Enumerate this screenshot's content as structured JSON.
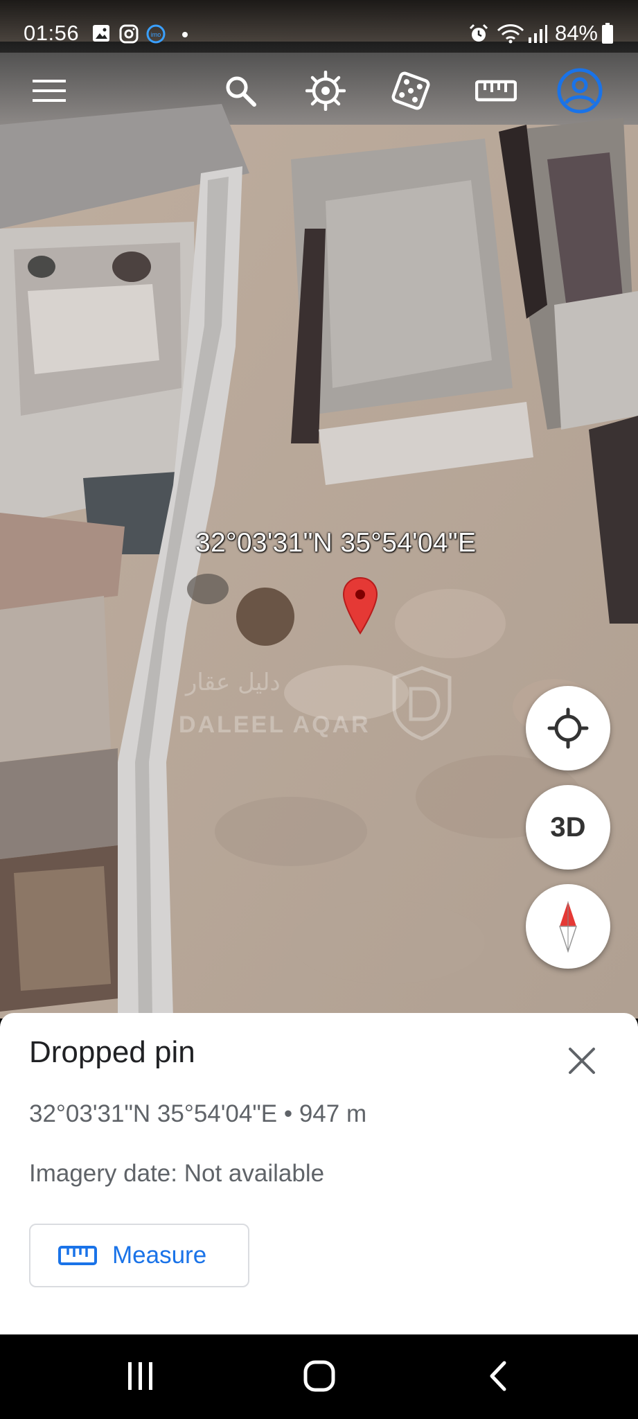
{
  "status_bar": {
    "time": "01:56",
    "battery": "84%",
    "notification_icons": [
      "gallery-icon",
      "instagram-icon",
      "imo-icon",
      "dot-icon"
    ],
    "system_icons": [
      "alarm-icon",
      "wifi-icon",
      "signal-icon",
      "battery-icon"
    ]
  },
  "toolbar": {
    "icons": [
      "menu-icon",
      "search-icon",
      "voyager-icon",
      "feeling-lucky-dice-icon",
      "ruler-icon",
      "account-icon"
    ]
  },
  "map": {
    "pin_label": "32°03'31\"N 35°54'04\"E",
    "watermark_arabic": "دليل عقار",
    "watermark_english": "DALEEL AQAR"
  },
  "fabs": {
    "three_d_label": "3D"
  },
  "sheet": {
    "title": "Dropped pin",
    "coordinates": "32°03'31\"N 35°54'04\"E • 947 m",
    "imagery": "Imagery date: Not available",
    "measure_label": "Measure"
  },
  "colors": {
    "accent": "#1a73e8",
    "pin": "#e53935",
    "account": "#1a73e8"
  }
}
